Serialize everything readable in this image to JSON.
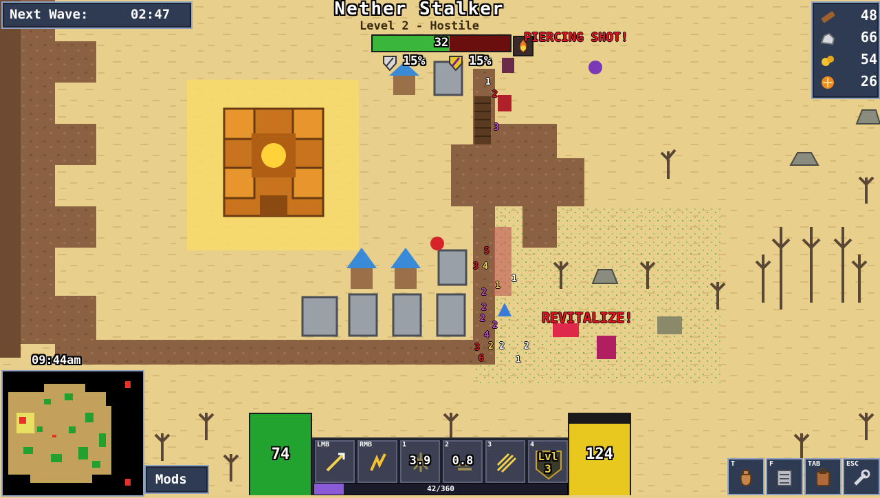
{
  "wave": {
    "label": "Next Wave:",
    "timer": "02:47"
  },
  "boss": {
    "name": "Nether Stalker",
    "level_status": "Level 2 - Hostile",
    "hp": "32",
    "hp_fraction": 0.56,
    "armor": "15%",
    "magic_resist": "15%"
  },
  "combat_text": {
    "ability1": "PIERCING SHOT!",
    "ability2": "REVITALIZE!"
  },
  "resources": [
    {
      "name": "wood",
      "icon": "log-icon",
      "value": "48",
      "color": "#a0622d"
    },
    {
      "name": "stone",
      "icon": "stone-icon",
      "value": "66",
      "color": "#d8d8e0"
    },
    {
      "name": "gold",
      "icon": "gold-nugget-icon",
      "value": "54",
      "color": "#f2c230"
    },
    {
      "name": "essence",
      "icon": "orange-orb-icon",
      "value": "26",
      "color": "#f08a1c"
    }
  ],
  "clock": "09:44am",
  "mods_label": "Mods",
  "player": {
    "health": "74",
    "health_color": "#22a330",
    "mana": "124",
    "mana_color": "#e8c81e",
    "xp_text": "42/360",
    "xp_fraction": 0.117
  },
  "abilities": [
    {
      "key": "LMB",
      "icon": "arrow-shot-icon",
      "cooldown": ""
    },
    {
      "key": "RMB",
      "icon": "lightning-arc-icon",
      "cooldown": ""
    },
    {
      "key": "1",
      "icon": "burst-icon",
      "cooldown": "3.9"
    },
    {
      "key": "2",
      "icon": "dash-icon",
      "cooldown": "0.8"
    },
    {
      "key": "3",
      "icon": "multishot-icon",
      "cooldown": ""
    },
    {
      "key": "4",
      "icon": "level-badge-icon",
      "cooldown": "",
      "badge_line1": "Lvl",
      "badge_line2": "3"
    }
  ],
  "menu_buttons": [
    {
      "key": "T",
      "icon": "bag-icon"
    },
    {
      "key": "F",
      "icon": "build-icon"
    },
    {
      "key": "TAB",
      "icon": "inventory-icon"
    },
    {
      "key": "ESC",
      "icon": "settings-wrench-icon"
    }
  ],
  "damage_numbers": [
    "1",
    "2",
    "3",
    "5",
    "3",
    "4",
    "1",
    "2",
    "1",
    "2",
    "4",
    "2",
    "2",
    "2",
    "6",
    "1",
    "2",
    "3",
    "2"
  ]
}
